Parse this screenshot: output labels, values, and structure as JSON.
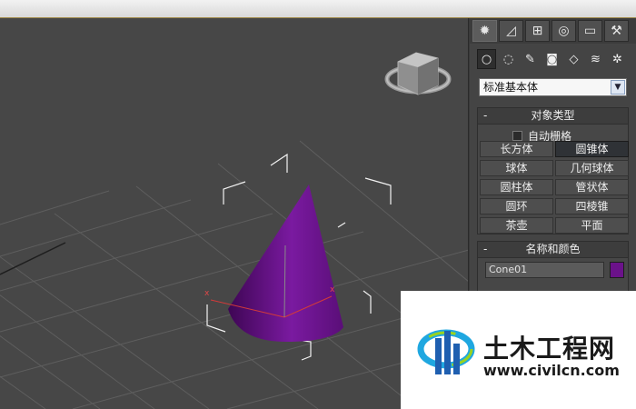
{
  "colors": {
    "accent": "#6b128a",
    "viewport_bg": "#474747",
    "grid": "#5c5c5c",
    "panel_bg": "#444444"
  },
  "command_tabs": [
    {
      "icon": "sun-create-icon",
      "glyph": "✹"
    },
    {
      "icon": "modify-curve-icon",
      "glyph": "◿"
    },
    {
      "icon": "hierarchy-icon",
      "glyph": "⊞"
    },
    {
      "icon": "motion-icon",
      "glyph": "◎"
    },
    {
      "icon": "display-monitor-icon",
      "glyph": "▭"
    },
    {
      "icon": "utilities-hammer-icon",
      "glyph": "⚒"
    }
  ],
  "create_categories": [
    {
      "icon": "geometry-sphere-icon",
      "glyph": "○"
    },
    {
      "icon": "shapes-icon",
      "glyph": "◌"
    },
    {
      "icon": "lights-icon",
      "glyph": "✎"
    },
    {
      "icon": "cameras-icon",
      "glyph": "◙"
    },
    {
      "icon": "helpers-icon",
      "glyph": "◇"
    },
    {
      "icon": "space-warps-icon",
      "glyph": "≋"
    },
    {
      "icon": "systems-icon",
      "glyph": "✲"
    }
  ],
  "geometry_dropdown": {
    "selected": "标准基本体"
  },
  "object_type": {
    "title": "对象类型",
    "collapse": "-",
    "autogrid_label": "自动栅格",
    "buttons": [
      {
        "label": "长方体",
        "name": "box-button",
        "active": false
      },
      {
        "label": "圆锥体",
        "name": "cone-button",
        "active": true
      },
      {
        "label": "球体",
        "name": "sphere-button",
        "active": false
      },
      {
        "label": "几何球体",
        "name": "geosphere-button",
        "active": false
      },
      {
        "label": "圆柱体",
        "name": "cylinder-button",
        "active": false
      },
      {
        "label": "管状体",
        "name": "tube-button",
        "active": false
      },
      {
        "label": "圆环",
        "name": "torus-button",
        "active": false
      },
      {
        "label": "四棱锥",
        "name": "pyramid-button",
        "active": false
      },
      {
        "label": "茶壶",
        "name": "teapot-button",
        "active": false
      },
      {
        "label": "平面",
        "name": "plane-button",
        "active": false
      }
    ]
  },
  "name_color": {
    "title": "名称和颜色",
    "collapse": "-",
    "object_name": "Cone01",
    "color": "#6b128a"
  },
  "watermark": {
    "title": "土木工程网",
    "url": "www.civilcn.com"
  }
}
